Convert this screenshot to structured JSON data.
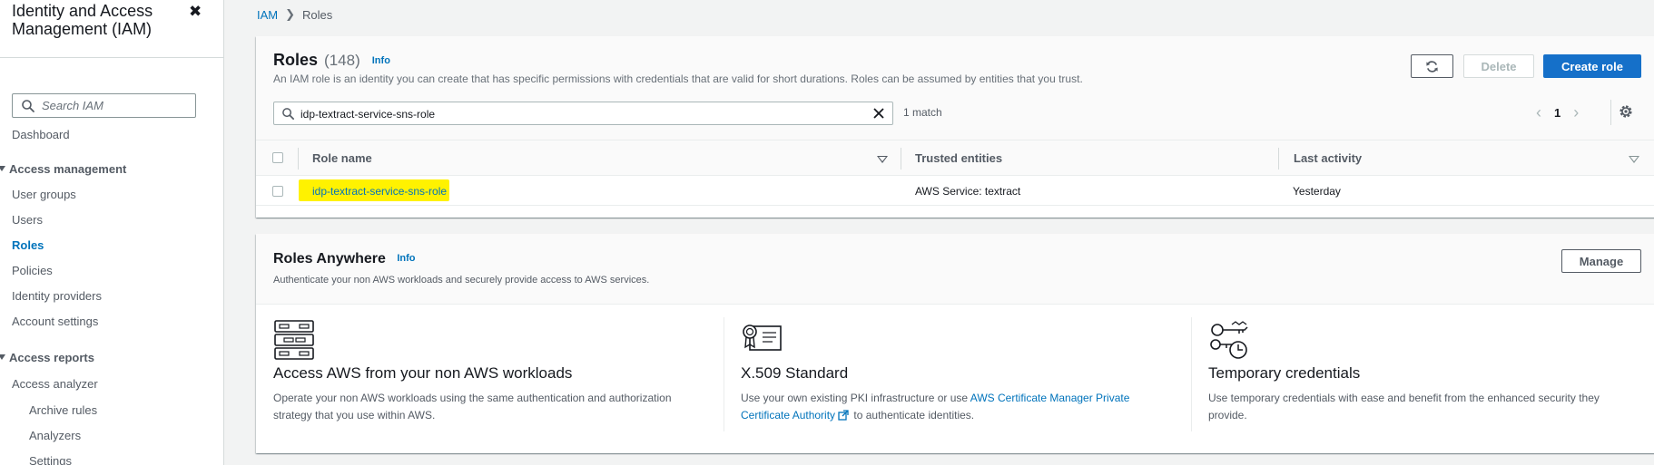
{
  "sidebar": {
    "title": "Identity and Access Management (IAM)",
    "search_placeholder": "Search IAM",
    "dashboard": "Dashboard",
    "access_management": {
      "label": "Access management",
      "items": [
        "User groups",
        "Users",
        "Roles",
        "Policies",
        "Identity providers",
        "Account settings"
      ]
    },
    "access_reports": {
      "label": "Access reports",
      "items": [
        "Access analyzer",
        "Archive rules",
        "Analyzers",
        "Settings"
      ]
    },
    "active_item": "Roles"
  },
  "breadcrumb": {
    "root": "IAM",
    "current": "Roles"
  },
  "roles": {
    "title": "Roles",
    "count": "(148)",
    "info": "Info",
    "description": "An IAM role is an identity you can create that has specific permissions with credentials that are valid for short durations. Roles can be assumed by entities that you trust.",
    "delete_label": "Delete",
    "create_label": "Create role",
    "filter_value": "idp-textract-service-sns-role",
    "match_text": "1 match",
    "page": "1",
    "columns": [
      "Role name",
      "Trusted entities",
      "Last activity"
    ],
    "rows": [
      {
        "role_name": "idp-textract-service-sns-role",
        "trusted_entities": "AWS Service: textract",
        "last_activity": "Yesterday"
      }
    ],
    "highlight_color": "#fff200"
  },
  "roles_anywhere": {
    "title": "Roles Anywhere",
    "info": "Info",
    "description": "Authenticate your non AWS workloads and securely provide access to AWS services.",
    "manage_label": "Manage",
    "features": [
      {
        "title": "Access AWS from your non AWS workloads",
        "text": "Operate your non AWS workloads using the same authentication and authorization strategy that you use within AWS."
      },
      {
        "title": "X.509 Standard",
        "text_before": "Use your own existing PKI infrastructure or use ",
        "link": "AWS Certificate Manager Private Certificate Authority",
        "text_after": " to authenticate identities."
      },
      {
        "title": "Temporary credentials",
        "text": "Use temporary credentials with ease and benefit from the enhanced security they provide."
      }
    ]
  },
  "colors": {
    "link": "#0073bb",
    "primary_button": "#1570c9",
    "background": "#f2f3f3"
  }
}
